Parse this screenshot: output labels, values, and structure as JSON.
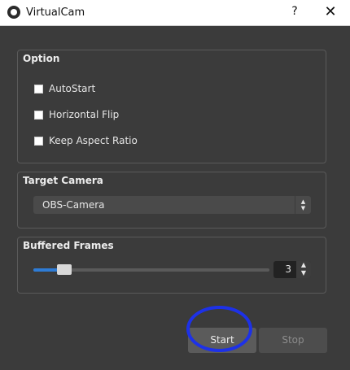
{
  "window": {
    "title": "VirtualCam",
    "help_label": "?",
    "close_label": "✕"
  },
  "option_group": {
    "title": "Option",
    "checkboxes": [
      {
        "label": "AutoStart",
        "checked": false
      },
      {
        "label": "Horizontal Flip",
        "checked": false
      },
      {
        "label": "Keep Aspect Ratio",
        "checked": false
      }
    ]
  },
  "target_camera": {
    "title": "Target Camera",
    "selected": "OBS-Camera"
  },
  "buffered_frames": {
    "title": "Buffered Frames",
    "value": "3",
    "slider_fraction": 0.13
  },
  "buttons": {
    "start": "Start",
    "stop": "Stop"
  },
  "colors": {
    "accent": "#2e7cd6",
    "highlight_ring": "#1d31e8",
    "background": "#3b3b3b"
  },
  "icons": {
    "app": "obs-logo-icon",
    "select_arrows": "up-down-chevron-icon",
    "spin_up": "chevron-up-icon",
    "spin_down": "chevron-down-icon"
  }
}
